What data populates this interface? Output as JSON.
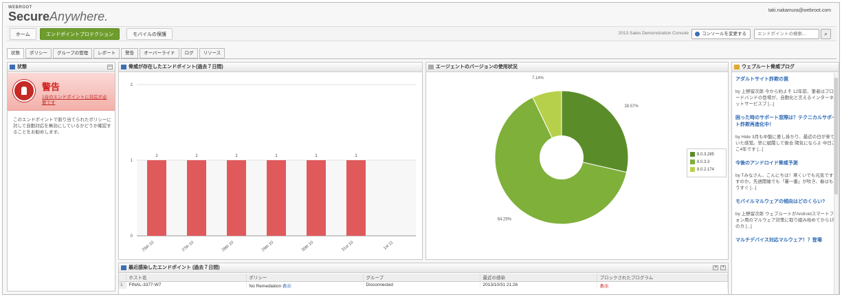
{
  "brand": {
    "top": "WEBROOT",
    "secure": "Secure",
    "anywhere": "Anywhere."
  },
  "user": {
    "email": "taki.nakamura@webroot.com"
  },
  "main_nav": {
    "tabs": [
      {
        "label": "ホーム",
        "active": false
      },
      {
        "label": "エンドポイントプロテクション",
        "active": true
      },
      {
        "label": "モバイルの保護",
        "active": false
      }
    ],
    "console_name": "2013 Sales Demonstration Console",
    "console_button": "コンソールを変更する",
    "search_placeholder": "エンドポイントの検索..."
  },
  "sub_nav": {
    "tabs": [
      {
        "label": "状態",
        "active": true
      },
      {
        "label": "ポリシー"
      },
      {
        "label": "グループの管理"
      },
      {
        "label": "レポート"
      },
      {
        "label": "警告"
      },
      {
        "label": "オーバーライド"
      },
      {
        "label": "ログ"
      },
      {
        "label": "リソース"
      }
    ]
  },
  "status_panel": {
    "title": "状態",
    "alert_title": "警告",
    "alert_link": "1台のエンドポイントに対応が必要です",
    "description": "このエンドポイントで割り当てられたポリシーに対して自動対応を無効にしているかどうか確認することをお勧めします。"
  },
  "threat_chart_panel": {
    "title": "脅威が存在したエンドポイント(過去７日間)"
  },
  "version_chart_panel": {
    "title": "エージェントのバージョンの使用状況"
  },
  "recent_panel": {
    "title": "最近感染したエンドポイント (過去７日間)",
    "columns": [
      "ホスト名",
      "ポリシー",
      "グループ",
      "最近の感染",
      "ブロックされたプログラム"
    ],
    "rows": [
      {
        "num": "1",
        "host": "FINAL-3377-W7",
        "policy": "No Remediation",
        "policy_link": "表示",
        "group": "Disconnected",
        "last": "2013/10/31 21:26",
        "blocked": "表示"
      }
    ]
  },
  "blog_panel": {
    "title": "ウェブルート脅威ブログ",
    "posts": [
      {
        "title": "アダルトサイト詐欺の罠",
        "body": "by 上野留次郎 今から約よそ 12年前、筆者はプロードバンドの登場が、自動化と言えるインターネットサービスプ [...]"
      },
      {
        "title": "困った時のサポート窓際は？テクニカルサポート詐欺再進化中！",
        "body": "by Hide 3月も中盤に差し掛かり、最近の日が来ていた感覚。早に組閣して後合 陽気にならよ 中日ここ4年です [...]"
      },
      {
        "title": "今後のアンドロイド脅威予測",
        "body": "by Tみなさん、こんにちは！寒くいでも元気ですすのか。先週開催でも「暑一番」が吹き、春はもうすぐ [...]"
      },
      {
        "title": "モバイルマルウェアの傾向はどのくらい?",
        "body": "by 上野留次郎 ウェブルートがAndroidスマートフォン用のマルウェア対策に取り組み始めてから1年のカ [...]"
      },
      {
        "title": "マルチデバイス対応マルウェア！？登場",
        "body": ""
      }
    ]
  },
  "chart_data": [
    {
      "type": "bar",
      "categories": [
        "25th 10",
        "27th 10",
        "28th 10",
        "29th 10",
        "30th 10",
        "31st 10",
        "1st 11"
      ],
      "values": [
        1,
        1,
        1,
        1,
        1,
        1,
        0
      ],
      "data_labels": [
        "1",
        "1",
        "1",
        "1",
        "1",
        "1",
        ""
      ],
      "ylim": [
        0,
        2
      ],
      "yticks": [
        0,
        1,
        2
      ],
      "grid": true,
      "color": "#e05a5c"
    },
    {
      "type": "pie",
      "donut": true,
      "series": [
        {
          "name": "8.0.3.285",
          "value": 28.57,
          "label": "28.57%",
          "color": "#5a8d2a"
        },
        {
          "name": "8.0.3.3",
          "value": 64.29,
          "label": "64.29%",
          "color": "#7fb03a"
        },
        {
          "name": "8.0.2.174",
          "value": 7.14,
          "label": "7.14%",
          "color": "#b7d04b"
        }
      ],
      "legend": "right"
    }
  ]
}
